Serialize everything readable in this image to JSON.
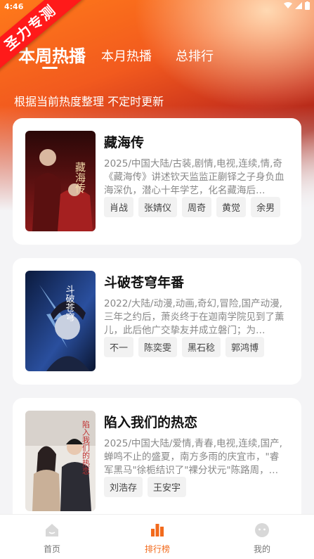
{
  "status_bar": {
    "time": "4:46"
  },
  "ribbon": {
    "text": "圣力专测"
  },
  "tabs": [
    {
      "label": "本周热播",
      "active": true
    },
    {
      "label": "本月热播",
      "active": false
    },
    {
      "label": "总排行",
      "active": false
    }
  ],
  "subtitle": "根据当前热度整理 不定时更新",
  "cards": [
    {
      "title": "藏海传",
      "meta": "2025/中国大陆/古装,剧情,电视,连续,情,奇",
      "desc": "《藏海传》讲述钦天监监正蒯铎之子身负血海深仇，潜心十年学艺，化名藏海后…",
      "cast": [
        "肖战",
        "张婧仪",
        "周奇",
        "黄觉",
        "余男"
      ],
      "poster_text": "藏海传",
      "poster_colors": [
        "#3a0c0c",
        "#8b1a1a"
      ]
    },
    {
      "title": "斗破苍穹年番",
      "meta": "2022/大陆/动漫,动画,奇幻,冒险,国产动漫,",
      "desc": "三年之约后，萧炎终于在迦南学院见到了薰儿，此后他广交挚友并成立磐门；为…",
      "cast": [
        "不一",
        "陈奕雯",
        "黑石稔",
        "郭鸿博"
      ],
      "poster_text": "斗破苍穹",
      "poster_colors": [
        "#0b1a3d",
        "#3a6fd8"
      ]
    },
    {
      "title": "陷入我们的热恋",
      "meta": "2025/中国大陆/爱情,青春,电视,连续,国产,",
      "desc": "蝉鸣不止的盛夏，南方多雨的庆宜市，\"睿军黑马\"徐栀结识了\"裸分状元\"陈路周，…",
      "cast": [
        "刘浩存",
        "王安宇"
      ],
      "poster_text": "陷入我们的热恋",
      "poster_colors": [
        "#e8e4e0",
        "#c9b8a8"
      ]
    }
  ],
  "bottom_nav": [
    {
      "label": "首页",
      "icon": "home-icon",
      "active": false
    },
    {
      "label": "排行榜",
      "icon": "ranking-icon",
      "active": true
    },
    {
      "label": "我的",
      "icon": "profile-icon",
      "active": false
    }
  ],
  "colors": {
    "accent": "#f26a1c",
    "ribbon": "#ff1a1a"
  }
}
